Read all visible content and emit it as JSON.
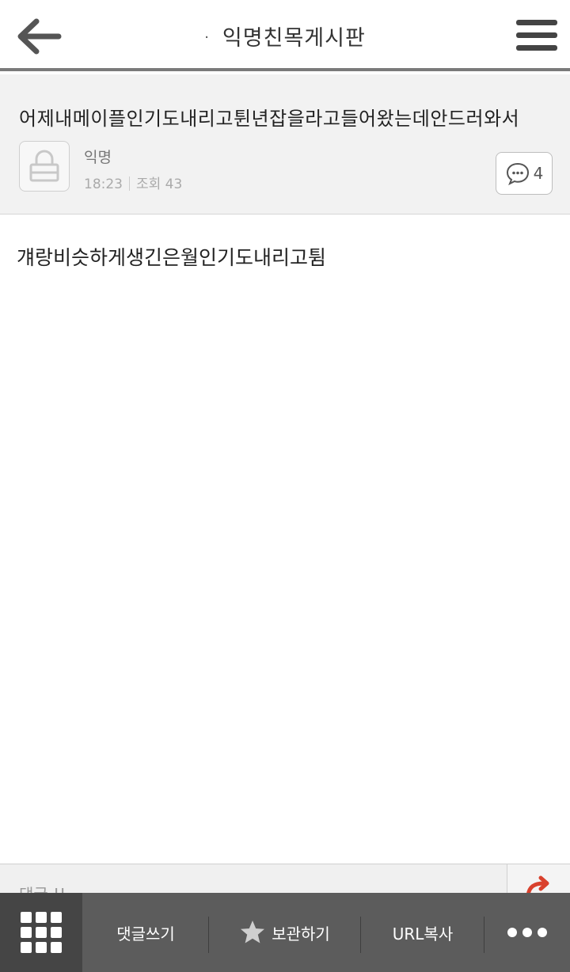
{
  "header": {
    "title": "익명친목게시판",
    "back_icon": "arrow-left-icon",
    "menu_icon": "hamburger-menu-icon"
  },
  "post": {
    "title": "어제내메이플인기도내리고튄년잡을라고들어왔는데안드러와서",
    "author": "익명",
    "time": "18:23",
    "views": "조회 43",
    "comment_count": "4",
    "body": "걔랑비슷하게생긴은월인기도내리고튐"
  },
  "comment_strip": {
    "label": "댓글 !!"
  },
  "toolbar": {
    "write_comment": "댓글쓰기",
    "bookmark": "보관하기",
    "copy_url": "URL복사"
  },
  "colors": {
    "toolbar_bg": "#5c5c5c",
    "toolbar_active": "#454545",
    "share_arrow": "#d9412d"
  }
}
